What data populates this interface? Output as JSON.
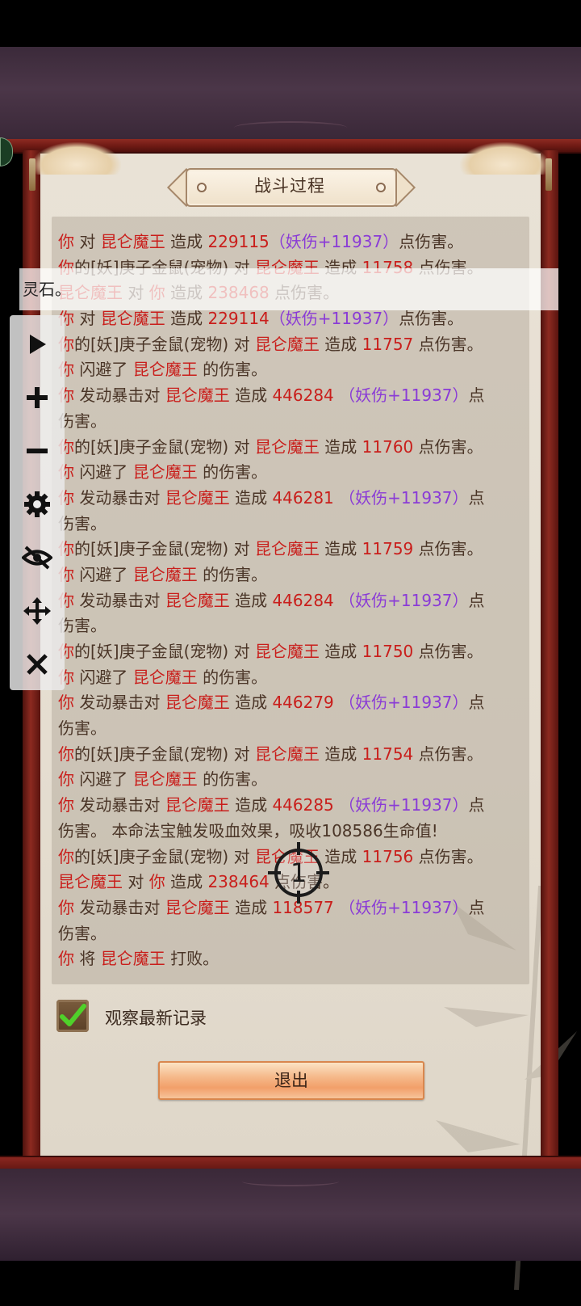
{
  "title": "战斗过程",
  "toast_text": "灵石。",
  "battle_log": [
    [
      {
        "t": "你",
        "c": "red"
      },
      {
        "t": " 对 ",
        "c": "dark"
      },
      {
        "t": "昆仑魔王",
        "c": "red"
      },
      {
        "t": " 造成 ",
        "c": "dark"
      },
      {
        "t": "229115",
        "c": "red"
      },
      {
        "t": "（妖伤+11937）",
        "c": "purple"
      },
      {
        "t": "点伤害。",
        "c": "dark"
      }
    ],
    [
      {
        "t": "你",
        "c": "red"
      },
      {
        "t": "的[妖]庚子金鼠(宠物) 对 ",
        "c": "dark"
      },
      {
        "t": "昆仑魔王",
        "c": "red"
      },
      {
        "t": " 造成 ",
        "c": "dark"
      },
      {
        "t": "11758",
        "c": "red"
      },
      {
        "t": " 点伤害。",
        "c": "dark"
      }
    ],
    [
      {
        "t": "昆仑魔王",
        "c": "red"
      },
      {
        "t": " 对 ",
        "c": "dark"
      },
      {
        "t": "你",
        "c": "red"
      },
      {
        "t": " 造成 ",
        "c": "dark"
      },
      {
        "t": "238468",
        "c": "red"
      },
      {
        "t": " 点伤害。",
        "c": "dark"
      }
    ],
    [
      {
        "t": "你",
        "c": "red"
      },
      {
        "t": " 对 ",
        "c": "dark"
      },
      {
        "t": "昆仑魔王",
        "c": "red"
      },
      {
        "t": " 造成 ",
        "c": "dark"
      },
      {
        "t": "229114",
        "c": "red"
      },
      {
        "t": "（妖伤+11937）",
        "c": "purple"
      },
      {
        "t": "点伤害。",
        "c": "dark"
      }
    ],
    [
      {
        "t": "你",
        "c": "red"
      },
      {
        "t": "的[妖]庚子金鼠(宠物) 对 ",
        "c": "dark"
      },
      {
        "t": "昆仑魔王",
        "c": "red"
      },
      {
        "t": " 造成 ",
        "c": "dark"
      },
      {
        "t": "11757",
        "c": "red"
      },
      {
        "t": " 点伤害。",
        "c": "dark"
      }
    ],
    [
      {
        "t": "你",
        "c": "red"
      },
      {
        "t": " 闪避了 ",
        "c": "dark"
      },
      {
        "t": "昆仑魔王",
        "c": "red"
      },
      {
        "t": " 的伤害。",
        "c": "dark"
      }
    ],
    [
      {
        "t": "你",
        "c": "red"
      },
      {
        "t": " 发动暴击对 ",
        "c": "dark"
      },
      {
        "t": "昆仑魔王",
        "c": "red"
      },
      {
        "t": " 造成 ",
        "c": "dark"
      },
      {
        "t": "446284",
        "c": "red"
      },
      {
        "t": " （妖伤+11937）",
        "c": "purple"
      },
      {
        "t": "点",
        "c": "dark"
      }
    ],
    [
      {
        "t": "伤害。",
        "c": "dark"
      }
    ],
    [
      {
        "t": "你",
        "c": "red"
      },
      {
        "t": "的[妖]庚子金鼠(宠物) 对 ",
        "c": "dark"
      },
      {
        "t": "昆仑魔王",
        "c": "red"
      },
      {
        "t": " 造成 ",
        "c": "dark"
      },
      {
        "t": "11760",
        "c": "red"
      },
      {
        "t": " 点伤害。",
        "c": "dark"
      }
    ],
    [
      {
        "t": "你",
        "c": "red"
      },
      {
        "t": " 闪避了 ",
        "c": "dark"
      },
      {
        "t": "昆仑魔王",
        "c": "red"
      },
      {
        "t": " 的伤害。",
        "c": "dark"
      }
    ],
    [
      {
        "t": "你",
        "c": "red"
      },
      {
        "t": " 发动暴击对 ",
        "c": "dark"
      },
      {
        "t": "昆仑魔王",
        "c": "red"
      },
      {
        "t": " 造成 ",
        "c": "dark"
      },
      {
        "t": "446281",
        "c": "red"
      },
      {
        "t": " （妖伤+11937）",
        "c": "purple"
      },
      {
        "t": "点",
        "c": "dark"
      }
    ],
    [
      {
        "t": "伤害。",
        "c": "dark"
      }
    ],
    [
      {
        "t": "你",
        "c": "red"
      },
      {
        "t": "的[妖]庚子金鼠(宠物) 对 ",
        "c": "dark"
      },
      {
        "t": "昆仑魔王",
        "c": "red"
      },
      {
        "t": " 造成 ",
        "c": "dark"
      },
      {
        "t": "11759",
        "c": "red"
      },
      {
        "t": " 点伤害。",
        "c": "dark"
      }
    ],
    [
      {
        "t": "你",
        "c": "red"
      },
      {
        "t": " 闪避了 ",
        "c": "dark"
      },
      {
        "t": "昆仑魔王",
        "c": "red"
      },
      {
        "t": " 的伤害。",
        "c": "dark"
      }
    ],
    [
      {
        "t": "你",
        "c": "red"
      },
      {
        "t": " 发动暴击对 ",
        "c": "dark"
      },
      {
        "t": "昆仑魔王",
        "c": "red"
      },
      {
        "t": " 造成 ",
        "c": "dark"
      },
      {
        "t": "446284",
        "c": "red"
      },
      {
        "t": " （妖伤+11937）",
        "c": "purple"
      },
      {
        "t": "点",
        "c": "dark"
      }
    ],
    [
      {
        "t": "伤害。",
        "c": "dark"
      }
    ],
    [
      {
        "t": "你",
        "c": "red"
      },
      {
        "t": "的[妖]庚子金鼠(宠物) 对 ",
        "c": "dark"
      },
      {
        "t": "昆仑魔王",
        "c": "red"
      },
      {
        "t": " 造成 ",
        "c": "dark"
      },
      {
        "t": "11750",
        "c": "red"
      },
      {
        "t": " 点伤害。",
        "c": "dark"
      }
    ],
    [
      {
        "t": "你",
        "c": "red"
      },
      {
        "t": " 闪避了 ",
        "c": "dark"
      },
      {
        "t": "昆仑魔王",
        "c": "red"
      },
      {
        "t": " 的伤害。",
        "c": "dark"
      }
    ],
    [
      {
        "t": "你",
        "c": "red"
      },
      {
        "t": " 发动暴击对 ",
        "c": "dark"
      },
      {
        "t": "昆仑魔王",
        "c": "red"
      },
      {
        "t": " 造成 ",
        "c": "dark"
      },
      {
        "t": "446279",
        "c": "red"
      },
      {
        "t": " （妖伤+11937）",
        "c": "purple"
      },
      {
        "t": "点",
        "c": "dark"
      }
    ],
    [
      {
        "t": "伤害。",
        "c": "dark"
      }
    ],
    [
      {
        "t": "你",
        "c": "red"
      },
      {
        "t": "的[妖]庚子金鼠(宠物) 对 ",
        "c": "dark"
      },
      {
        "t": "昆仑魔王",
        "c": "red"
      },
      {
        "t": " 造成 ",
        "c": "dark"
      },
      {
        "t": "11754",
        "c": "red"
      },
      {
        "t": " 点伤害。",
        "c": "dark"
      }
    ],
    [
      {
        "t": "你",
        "c": "red"
      },
      {
        "t": " 闪避了 ",
        "c": "dark"
      },
      {
        "t": "昆仑魔王",
        "c": "red"
      },
      {
        "t": " 的伤害。",
        "c": "dark"
      }
    ],
    [
      {
        "t": "你",
        "c": "red"
      },
      {
        "t": " 发动暴击对 ",
        "c": "dark"
      },
      {
        "t": "昆仑魔王",
        "c": "red"
      },
      {
        "t": " 造成 ",
        "c": "dark"
      },
      {
        "t": "446285",
        "c": "red"
      },
      {
        "t": " （妖伤+11937）",
        "c": "purple"
      },
      {
        "t": "点",
        "c": "dark"
      }
    ],
    [
      {
        "t": "伤害。 本命法宝触发吸血效果，吸收108586生命值!",
        "c": "dark"
      }
    ],
    [
      {
        "t": "你",
        "c": "red"
      },
      {
        "t": "的[妖]庚子金鼠(宠物) 对 ",
        "c": "dark"
      },
      {
        "t": "昆仑魔王",
        "c": "red"
      },
      {
        "t": " 造成 ",
        "c": "dark"
      },
      {
        "t": "11756",
        "c": "red"
      },
      {
        "t": " 点伤害。",
        "c": "dark"
      }
    ],
    [
      {
        "t": "昆仑魔王",
        "c": "red"
      },
      {
        "t": " 对 ",
        "c": "dark"
      },
      {
        "t": "你",
        "c": "red"
      },
      {
        "t": " 造成 ",
        "c": "dark"
      },
      {
        "t": "238464",
        "c": "red"
      },
      {
        "t": " 点伤害。",
        "c": "dark"
      }
    ],
    [
      {
        "t": "你",
        "c": "red"
      },
      {
        "t": " 发动暴击对 ",
        "c": "dark"
      },
      {
        "t": "昆仑魔王",
        "c": "red"
      },
      {
        "t": " 造成 ",
        "c": "dark"
      },
      {
        "t": "118577",
        "c": "red"
      },
      {
        "t": " （妖伤+11937）",
        "c": "purple"
      },
      {
        "t": "点",
        "c": "dark"
      }
    ],
    [
      {
        "t": "伤害。",
        "c": "dark"
      }
    ],
    [
      {
        "t": "你",
        "c": "red"
      },
      {
        "t": " 将 ",
        "c": "dark"
      },
      {
        "t": "昆仑魔王",
        "c": "red"
      },
      {
        "t": " 打败。",
        "c": "dark"
      }
    ]
  ],
  "checkbox": {
    "label": "观察最新记录",
    "checked": true
  },
  "exit_button_label": "退出",
  "crosshair_label": "1",
  "tools": [
    "play-icon",
    "plus-icon",
    "minus-icon",
    "gear-icon",
    "eye-off-icon",
    "move-icon",
    "close-icon"
  ],
  "colors": {
    "damage_red": "#c91e1b",
    "bonus_purple": "#8a3bd6",
    "text_brown": "#4a3527",
    "check_green": "#4fd12a"
  }
}
